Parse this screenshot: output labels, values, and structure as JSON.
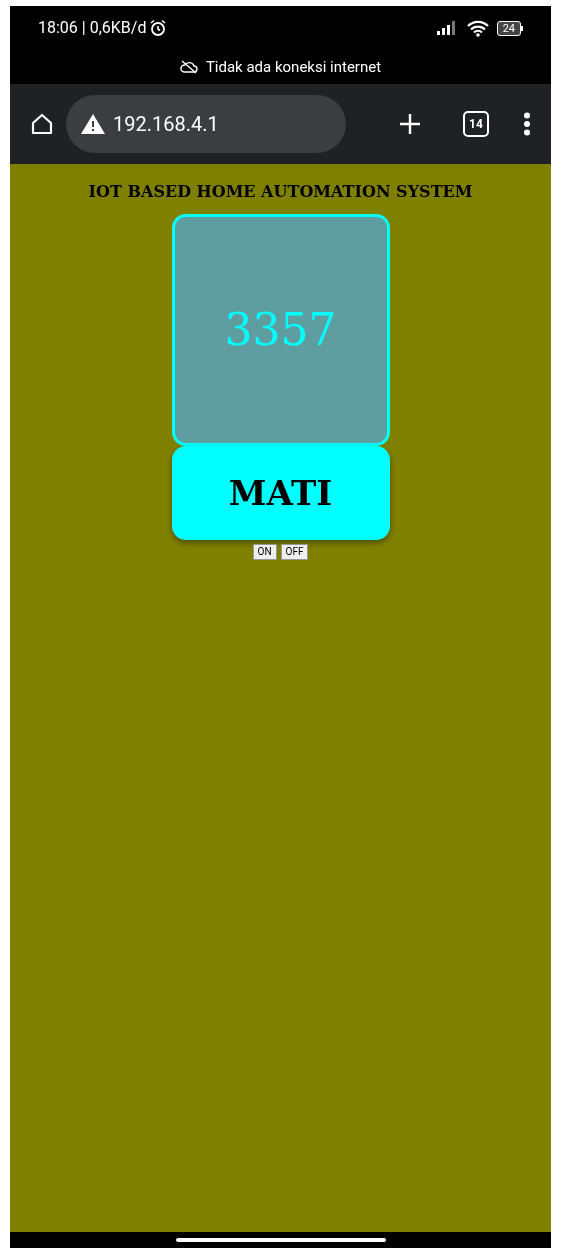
{
  "status_bar": {
    "time": "18:06 | 0,6KB/d",
    "battery": "24",
    "notice": "Tidak ada koneksi internet"
  },
  "browser": {
    "url": "192.168.4.1",
    "tab_count": "14"
  },
  "page": {
    "heading": "IOT BASED HOME AUTOMATION SYSTEM",
    "reading": "3357",
    "state_label": "MATI",
    "buttons": [
      "ON",
      "OFF"
    ]
  }
}
